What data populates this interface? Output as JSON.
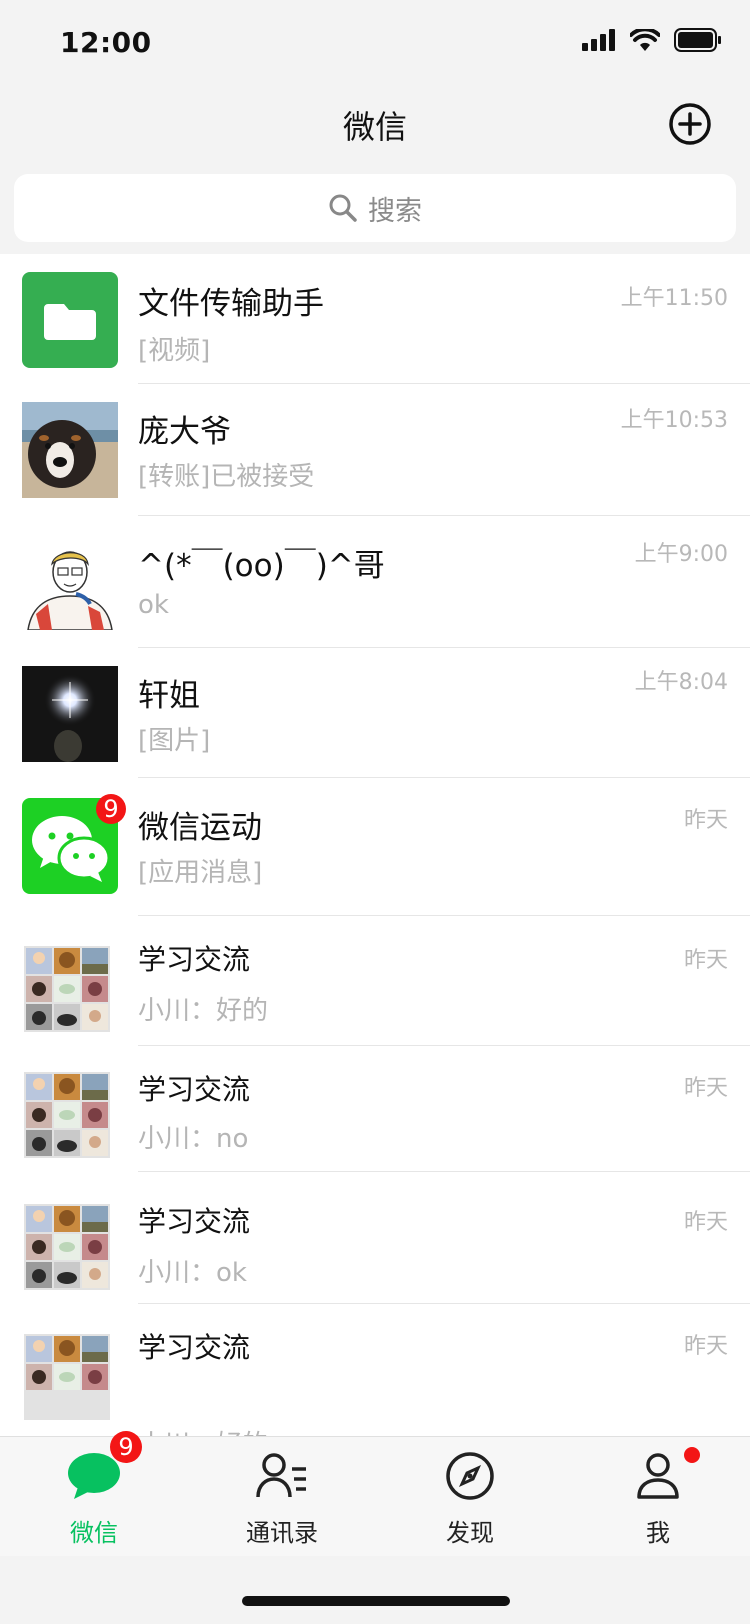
{
  "status": {
    "time": "12:00"
  },
  "nav": {
    "title": "微信"
  },
  "search": {
    "placeholder": "搜索"
  },
  "colors": {
    "accent": "#07c160",
    "badge": "#f31616",
    "file_helper": "#35ae51",
    "wechat_sport": "#1dd024"
  },
  "chats": [
    {
      "name": "文件传输助手",
      "preview": "[视频]",
      "time": "上午11:50",
      "avatar": "folder-icon"
    },
    {
      "name": "庞大爷",
      "preview": "[转账]已被接受",
      "time": "上午10:53",
      "avatar": "dog-photo"
    },
    {
      "name": "^(*￣(oo)￣)^哥",
      "preview": "ok",
      "time": "上午9:00",
      "avatar": "cartoon-person"
    },
    {
      "name": "轩姐",
      "preview": "[图片]",
      "time": "上午8:04",
      "avatar": "dark-photo"
    },
    {
      "name": "微信运动",
      "preview": "[应用消息]",
      "time": "昨天",
      "avatar": "wechat-logo",
      "badge": "9"
    },
    {
      "name": "学习交流",
      "preview": "小川：好的",
      "time": "昨天",
      "avatar": "group-grid"
    },
    {
      "name": "学习交流",
      "preview": "小川：no",
      "time": "昨天",
      "avatar": "group-grid"
    },
    {
      "name": "学习交流",
      "preview": "小川：ok",
      "time": "昨天",
      "avatar": "group-grid"
    },
    {
      "name": "学习交流",
      "preview": "小川：好的",
      "time": "昨天",
      "avatar": "group-grid"
    }
  ],
  "tabs": [
    {
      "label": "微信",
      "icon": "chat-bubble-icon",
      "active": true,
      "badge": "9"
    },
    {
      "label": "通讯录",
      "icon": "contacts-icon"
    },
    {
      "label": "发现",
      "icon": "compass-icon"
    },
    {
      "label": "我",
      "icon": "person-icon",
      "dot": true
    }
  ]
}
